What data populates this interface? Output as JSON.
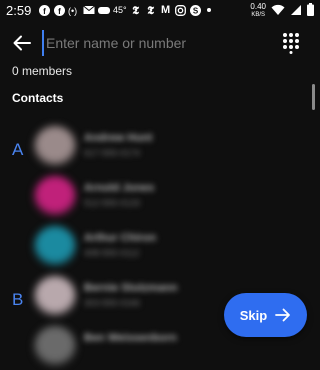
{
  "status_bar": {
    "time": "2:59",
    "notification_icons": [
      "facebook-icon",
      "facebook-icon",
      "podcast-icon",
      "email-icon",
      "game-icon",
      "temperature-text",
      "nyt-icon",
      "nyt-icon",
      "gmail-icon",
      "instagram-icon",
      "shazam-icon",
      "dot-icon"
    ],
    "temperature": "45°",
    "net_speed_value": "0.40",
    "net_speed_unit": "KB/S",
    "system_icons": [
      "wifi-icon",
      "signal-icon",
      "battery-icon"
    ]
  },
  "header": {
    "search_placeholder": "Enter name or number",
    "back_icon": "arrow-left-icon",
    "dialpad_icon": "dialpad-icon"
  },
  "members_count": "0 members",
  "section_title": "Contacts",
  "groups": [
    {
      "letter": "A",
      "contacts": [
        {
          "name": "Andrew Hunt",
          "number": "617-555-0174",
          "avatar_color": "#9a8a8a"
        },
        {
          "name": "Arnold Jones",
          "number": "512-555-0133",
          "avatar_color": "#c0217a"
        },
        {
          "name": "Arthur Chiron",
          "number": "408-555-0112",
          "avatar_color": "#1b8aa0"
        }
      ]
    },
    {
      "letter": "B",
      "contacts": [
        {
          "name": "Bernie Stutzmann",
          "number": "303-555-0166",
          "avatar_color": "#b8a8ac"
        },
        {
          "name": "Ben Weissenborn",
          "number": "202-555-0191",
          "avatar_color": "#6a6a6a"
        }
      ]
    }
  ],
  "skip_button": {
    "label": "Skip",
    "icon": "arrow-right-icon"
  },
  "colors": {
    "accent": "#2f6df0",
    "letter": "#4a84f0",
    "background": "#0f0f0f"
  }
}
